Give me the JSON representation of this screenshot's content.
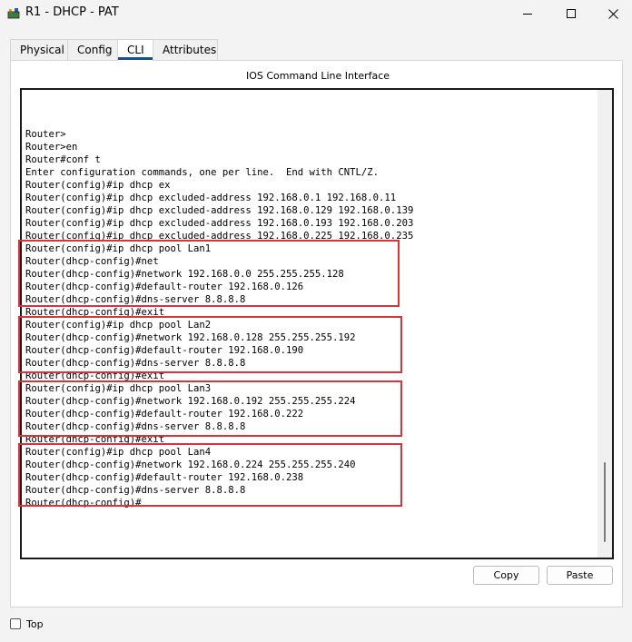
{
  "window": {
    "title": "R1 - DHCP - PAT",
    "icon": "router-app-icon"
  },
  "tabs": [
    {
      "label": "Physical",
      "active": false
    },
    {
      "label": "Config",
      "active": false
    },
    {
      "label": "CLI",
      "active": true
    },
    {
      "label": "Attributes",
      "active": false
    }
  ],
  "cli": {
    "heading": "IOS Command Line Interface",
    "lines": [
      "Router>",
      "Router>en",
      "Router#conf t",
      "Enter configuration commands, one per line.  End with CNTL/Z.",
      "Router(config)#ip dhcp ex",
      "Router(config)#ip dhcp excluded-address 192.168.0.1 192.168.0.11",
      "Router(config)#ip dhcp excluded-address 192.168.0.129 192.168.0.139",
      "Router(config)#ip dhcp excluded-address 192.168.0.193 192.168.0.203",
      "Router(config)#ip dhcp excluded-address 192.168.0.225 192.168.0.235",
      "Router(config)#ip dhcp pool Lan1",
      "Router(dhcp-config)#net",
      "Router(dhcp-config)#network 192.168.0.0 255.255.255.128",
      "Router(dhcp-config)#default-router 192.168.0.126",
      "Router(dhcp-config)#dns-server 8.8.8.8",
      "Router(dhcp-config)#exit",
      "Router(config)#ip dhcp pool Lan2",
      "Router(dhcp-config)#network 192.168.0.128 255.255.255.192",
      "Router(dhcp-config)#default-router 192.168.0.190",
      "Router(dhcp-config)#dns-server 8.8.8.8",
      "Router(dhcp-config)#exit",
      "Router(config)#ip dhcp pool Lan3",
      "Router(dhcp-config)#network 192.168.0.192 255.255.255.224",
      "Router(dhcp-config)#default-router 192.168.0.222",
      "Router(dhcp-config)#dns-server 8.8.8.8",
      "Router(dhcp-config)#exit",
      "Router(config)#ip dhcp pool Lan4",
      "Router(dhcp-config)#network 192.168.0.224 255.255.255.240",
      "Router(dhcp-config)#default-router 192.168.0.238",
      "Router(dhcp-config)#dns-server 8.8.8.8",
      "Router(dhcp-config)#"
    ]
  },
  "buttons": {
    "copy_label": "Copy",
    "paste_label": "Paste"
  },
  "footer": {
    "top_label": "Top",
    "top_checked": false
  },
  "colors": {
    "highlight": "#d9343a",
    "active_tab_indicator": "#1b4f8a"
  }
}
